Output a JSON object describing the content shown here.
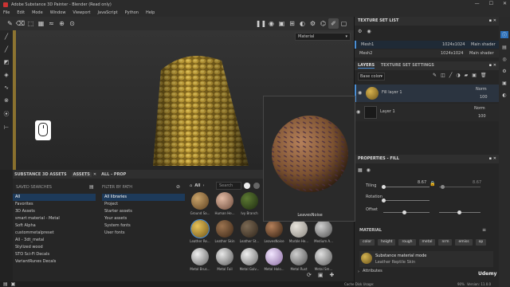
{
  "window": {
    "title": "Adobe Substance 3D Painter - Blender (Read only)"
  },
  "menu": [
    "File",
    "Edit",
    "Mode",
    "Window",
    "Viewport",
    "JavaScript",
    "Python",
    "Help"
  ],
  "viewport": {
    "channel": "Material"
  },
  "texture_set_list": {
    "title": "TEXTURE SET LIST",
    "items": [
      {
        "name": "Mesh1",
        "res": "1024x1024",
        "shader": "Main shader"
      },
      {
        "name": "Mesh2",
        "res": "1024x1024",
        "shader": "Main shader"
      }
    ]
  },
  "layers": {
    "tab1": "LAYERS",
    "tab2": "TEXTURE SET SETTINGS",
    "channel": "Base color",
    "items": [
      {
        "name": "Fill layer 1",
        "blend": "Norm",
        "opacity": "100"
      },
      {
        "name": "Layer 1",
        "blend": "Norm",
        "opacity": "100"
      }
    ]
  },
  "properties": {
    "title": "PROPERTIES - FILL",
    "tiling_label": "Tiling",
    "tiling_value": "8.67",
    "tiling_value2": "8.67",
    "rotation_label": "Rotation",
    "offset_label": "Offset"
  },
  "material": {
    "title": "MATERIAL",
    "chips": [
      "color",
      "height",
      "rough",
      "metal",
      "nrm",
      "emiss",
      "op"
    ],
    "mode_title": "Substance material mode",
    "mode_sub": "Leather Reptile Skin"
  },
  "attributes": {
    "label": "Attributes"
  },
  "assets": {
    "tab1": "SUBSTANCE 3D ASSETS",
    "tab2": "ASSETS",
    "tab3": "ALL - PROP",
    "saved_searches": "SAVED SEARCHES",
    "filter_label": "FILTER BY PATH",
    "search_placeholder": "Search",
    "all_tab": "All",
    "left_list": [
      "All",
      "Favorites",
      "3D Assets",
      "smart material - Metal",
      "Soft Alpha",
      "custommetalpreset",
      "All - 3dt_metal",
      "Stylized wood",
      "STO Sci-Fi Decals",
      "VariantRunes Decals"
    ],
    "middle_list": [
      "All libraries",
      "Project",
      "Starter assets",
      "Your assets",
      "System fonts",
      "User fonts"
    ],
    "thumbs": [
      "Ground Sa...",
      "Human He...",
      "Ivy Branch",
      "Large Nai...",
      "Leaves Dry",
      "Leaves Ne...",
      "Leather Re...",
      "Leather Skin",
      "Leather St...",
      "LeavesNoise",
      "Marble He...",
      "Medium A...",
      "Metal Brus...",
      "Metal Foil",
      "Metal Galv...",
      "Metal Holo...",
      "Metal Rust",
      "Metal Sm..."
    ]
  },
  "preview": {
    "name": "LeavesNoise"
  },
  "status": {
    "cache": "Cache Disk Usage:",
    "pct": "90%",
    "version": "Version: 11.0.0"
  },
  "watermark": "Udemy",
  "colors": {
    "accent": "#4b8fd6",
    "panel": "#262626"
  }
}
